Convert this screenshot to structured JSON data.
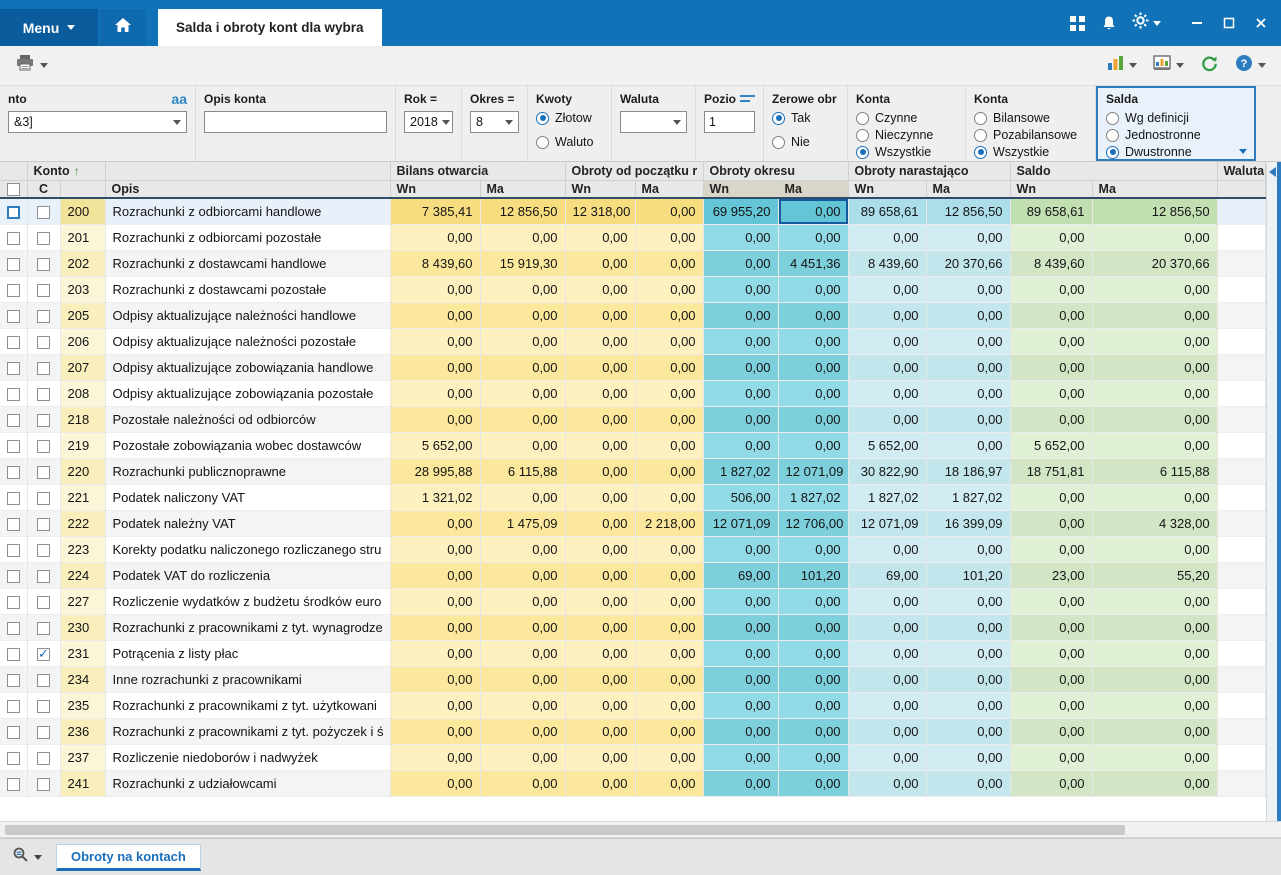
{
  "colors": {
    "accent_blue": "#1a6fbd",
    "col_yellow": "#fbe89c",
    "col_cyan": "#7ecfdc",
    "col_light_cyan": "#c2e6ec",
    "col_green": "#d2e6c6"
  },
  "titlebar": {
    "menu_label": "Menu",
    "tab_title": "Salda i obroty kont dla wybra"
  },
  "filters": {
    "konto": {
      "label": "nto",
      "value": "&3]"
    },
    "opis_konta": {
      "label": "Opis konta",
      "value": ""
    },
    "rok": {
      "label": "Rok =",
      "value": "2018"
    },
    "okres": {
      "label": "Okres =",
      "value": "8"
    },
    "kwoty": {
      "label": "Kwoty",
      "options": [
        "Złotow",
        "Waluto"
      ],
      "selected": "Złotow"
    },
    "waluta": {
      "label": "Waluta",
      "value": ""
    },
    "poziom": {
      "label": "Pozio",
      "value": "1"
    },
    "zerowe_obroty": {
      "label": "Zerowe obr",
      "options": [
        "Tak",
        "Nie"
      ],
      "selected": "Tak"
    },
    "konta_czynne": {
      "label": "Konta",
      "options": [
        "Czynne",
        "Nieczynne",
        "Wszystkie"
      ],
      "selected": "Wszystkie"
    },
    "konta_bilansowe": {
      "label": "Konta",
      "options": [
        "Bilansowe",
        "Pozabilansowe",
        "Wszystkie"
      ],
      "selected": "Wszystkie"
    },
    "salda": {
      "label": "Salda",
      "options": [
        "Wg definicji",
        "Jednostronne",
        "Dwustronne"
      ],
      "selected": "Dwustronne"
    }
  },
  "table": {
    "group_headers": {
      "konto": "Konto",
      "bilans_otwarcia": "Bilans otwarcia",
      "obroty_od_poczatku": "Obroty od początku r",
      "obroty_okresu": "Obroty okresu",
      "obroty_narastajaco": "Obroty narastająco",
      "saldo": "Saldo",
      "waluta": "Waluta"
    },
    "sub_headers": {
      "c": "C",
      "opis": "Opis",
      "wn": "Wn",
      "ma": "Ma"
    },
    "selected_konto": "200",
    "focused_cell": {
      "konto": "200",
      "value_index": 5
    },
    "rows": [
      {
        "konto": "200",
        "opis": "Rozrachunki z odbiorcami handlowe",
        "checked": false,
        "values": [
          "7 385,41",
          "12 856,50",
          "12 318,00",
          "0,00",
          "69 955,20",
          "0,00",
          "89 658,61",
          "12 856,50",
          "89 658,61",
          "12 856,50"
        ]
      },
      {
        "konto": "201",
        "opis": "Rozrachunki z odbiorcami pozostałe",
        "checked": false,
        "values": [
          "0,00",
          "0,00",
          "0,00",
          "0,00",
          "0,00",
          "0,00",
          "0,00",
          "0,00",
          "0,00",
          "0,00"
        ]
      },
      {
        "konto": "202",
        "opis": "Rozrachunki z dostawcami handlowe",
        "checked": false,
        "values": [
          "8 439,60",
          "15 919,30",
          "0,00",
          "0,00",
          "0,00",
          "4 451,36",
          "8 439,60",
          "20 370,66",
          "8 439,60",
          "20 370,66"
        ]
      },
      {
        "konto": "203",
        "opis": "Rozrachunki z dostawcami pozostałe",
        "checked": false,
        "values": [
          "0,00",
          "0,00",
          "0,00",
          "0,00",
          "0,00",
          "0,00",
          "0,00",
          "0,00",
          "0,00",
          "0,00"
        ]
      },
      {
        "konto": "205",
        "opis": "Odpisy aktualizujące należności handlowe",
        "checked": false,
        "values": [
          "0,00",
          "0,00",
          "0,00",
          "0,00",
          "0,00",
          "0,00",
          "0,00",
          "0,00",
          "0,00",
          "0,00"
        ]
      },
      {
        "konto": "206",
        "opis": "Odpisy aktualizujące należności pozostałe",
        "checked": false,
        "values": [
          "0,00",
          "0,00",
          "0,00",
          "0,00",
          "0,00",
          "0,00",
          "0,00",
          "0,00",
          "0,00",
          "0,00"
        ]
      },
      {
        "konto": "207",
        "opis": "Odpisy aktualizujące zobowiązania handlowe",
        "checked": false,
        "values": [
          "0,00",
          "0,00",
          "0,00",
          "0,00",
          "0,00",
          "0,00",
          "0,00",
          "0,00",
          "0,00",
          "0,00"
        ]
      },
      {
        "konto": "208",
        "opis": "Odpisy aktualizujące zobowiązania pozostałe",
        "checked": false,
        "values": [
          "0,00",
          "0,00",
          "0,00",
          "0,00",
          "0,00",
          "0,00",
          "0,00",
          "0,00",
          "0,00",
          "0,00"
        ]
      },
      {
        "konto": "218",
        "opis": "Pozostałe należności od odbiorców",
        "checked": false,
        "values": [
          "0,00",
          "0,00",
          "0,00",
          "0,00",
          "0,00",
          "0,00",
          "0,00",
          "0,00",
          "0,00",
          "0,00"
        ]
      },
      {
        "konto": "219",
        "opis": "Pozostałe zobowiązania wobec dostawców",
        "checked": false,
        "values": [
          "5 652,00",
          "0,00",
          "0,00",
          "0,00",
          "0,00",
          "0,00",
          "5 652,00",
          "0,00",
          "5 652,00",
          "0,00"
        ]
      },
      {
        "konto": "220",
        "opis": "Rozrachunki publicznoprawne",
        "checked": false,
        "values": [
          "28 995,88",
          "6 115,88",
          "0,00",
          "0,00",
          "1 827,02",
          "12 071,09",
          "30 822,90",
          "18 186,97",
          "18 751,81",
          "6 115,88"
        ]
      },
      {
        "konto": "221",
        "opis": "Podatek naliczony VAT",
        "checked": false,
        "values": [
          "1 321,02",
          "0,00",
          "0,00",
          "0,00",
          "506,00",
          "1 827,02",
          "1 827,02",
          "1 827,02",
          "0,00",
          "0,00"
        ]
      },
      {
        "konto": "222",
        "opis": "Podatek należny VAT",
        "checked": false,
        "values": [
          "0,00",
          "1 475,09",
          "0,00",
          "2 218,00",
          "12 071,09",
          "12 706,00",
          "12 071,09",
          "16 399,09",
          "0,00",
          "4 328,00"
        ]
      },
      {
        "konto": "223",
        "opis": "Korekty podatku naliczonego rozliczanego stru",
        "checked": false,
        "values": [
          "0,00",
          "0,00",
          "0,00",
          "0,00",
          "0,00",
          "0,00",
          "0,00",
          "0,00",
          "0,00",
          "0,00"
        ]
      },
      {
        "konto": "224",
        "opis": "Podatek VAT do rozliczenia",
        "checked": false,
        "values": [
          "0,00",
          "0,00",
          "0,00",
          "0,00",
          "69,00",
          "101,20",
          "69,00",
          "101,20",
          "23,00",
          "55,20"
        ]
      },
      {
        "konto": "227",
        "opis": "Rozliczenie wydatków z budżetu środków euro",
        "checked": false,
        "values": [
          "0,00",
          "0,00",
          "0,00",
          "0,00",
          "0,00",
          "0,00",
          "0,00",
          "0,00",
          "0,00",
          "0,00"
        ]
      },
      {
        "konto": "230",
        "opis": "Rozrachunki z pracownikami z tyt. wynagrodze",
        "checked": false,
        "values": [
          "0,00",
          "0,00",
          "0,00",
          "0,00",
          "0,00",
          "0,00",
          "0,00",
          "0,00",
          "0,00",
          "0,00"
        ]
      },
      {
        "konto": "231",
        "opis": "Potrącenia z listy płac",
        "checked": true,
        "values": [
          "0,00",
          "0,00",
          "0,00",
          "0,00",
          "0,00",
          "0,00",
          "0,00",
          "0,00",
          "0,00",
          "0,00"
        ]
      },
      {
        "konto": "234",
        "opis": "Inne rozrachunki z pracownikami",
        "checked": false,
        "values": [
          "0,00",
          "0,00",
          "0,00",
          "0,00",
          "0,00",
          "0,00",
          "0,00",
          "0,00",
          "0,00",
          "0,00"
        ]
      },
      {
        "konto": "235",
        "opis": "Rozrachunki z pracownikami z tyt. użytkowani",
        "checked": false,
        "values": [
          "0,00",
          "0,00",
          "0,00",
          "0,00",
          "0,00",
          "0,00",
          "0,00",
          "0,00",
          "0,00",
          "0,00"
        ]
      },
      {
        "konto": "236",
        "opis": "Rozrachunki z pracownikami z tyt. pożyczek i ś",
        "checked": false,
        "values": [
          "0,00",
          "0,00",
          "0,00",
          "0,00",
          "0,00",
          "0,00",
          "0,00",
          "0,00",
          "0,00",
          "0,00"
        ]
      },
      {
        "konto": "237",
        "opis": "Rozliczenie niedoborów i nadwyżek",
        "checked": false,
        "values": [
          "0,00",
          "0,00",
          "0,00",
          "0,00",
          "0,00",
          "0,00",
          "0,00",
          "0,00",
          "0,00",
          "0,00"
        ]
      },
      {
        "konto": "241",
        "opis": "Rozrachunki z udziałowcami",
        "checked": false,
        "values": [
          "0,00",
          "0,00",
          "0,00",
          "0,00",
          "0,00",
          "0,00",
          "0,00",
          "0,00",
          "0,00",
          "0,00"
        ]
      }
    ]
  },
  "footer": {
    "tab_label": "Obroty na kontach"
  }
}
